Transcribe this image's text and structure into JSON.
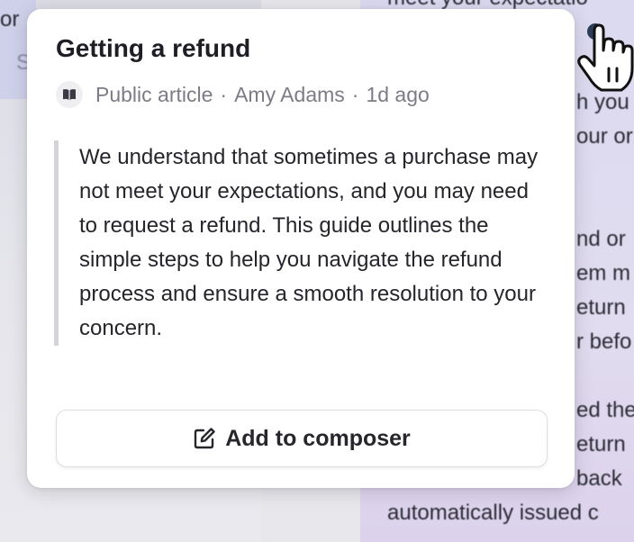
{
  "background": {
    "left_texts": [
      "or",
      "S"
    ],
    "right_texts": [
      "meet your expectatio",
      "h you",
      "our or",
      "nd or",
      "em m",
      "eturn",
      "r befo",
      "ed the",
      "eturn",
      "back",
      "automatically issued c"
    ]
  },
  "popover": {
    "title": "Getting a refund",
    "meta": {
      "visibility": "Public article",
      "author": "Amy Adams",
      "time": "1d ago",
      "separator": "·",
      "icon": "book-icon"
    },
    "excerpt": "We understand that sometimes a purchase may not meet your expectations, and you may need to request a refund. This guide outlines the simple steps to help you navigate the refund process and ensure a smooth resolution to your concern.",
    "add_button": {
      "label": "Add to composer",
      "icon": "compose-icon"
    }
  },
  "colors": {
    "card_bg": "#ffffff",
    "title": "#1e1e24",
    "meta": "#7c7c86",
    "quote_border": "#d4d4d8",
    "bg_right": "#dcdaf0"
  }
}
